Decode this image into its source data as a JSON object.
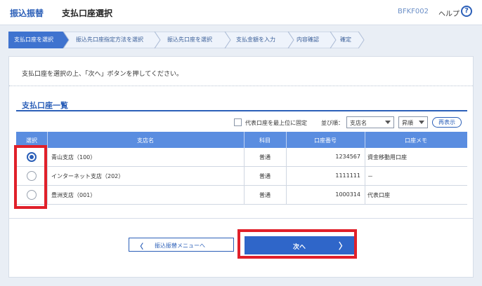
{
  "header": {
    "app_title": "振込振替",
    "page_title": "支払口座選択",
    "screen_id": "BFKF002",
    "help_label": "ヘルプ",
    "help_icon_text": "?"
  },
  "steps": [
    {
      "label": "支払口座を選択",
      "active": true
    },
    {
      "label": "振込先口座指定方法を選択",
      "active": false
    },
    {
      "label": "振込先口座を選択",
      "active": false
    },
    {
      "label": "支払金額を入力",
      "active": false
    },
    {
      "label": "内容確認",
      "active": false
    },
    {
      "label": "確定",
      "active": false
    }
  ],
  "instruction": "支払口座を選択の上、「次へ」ボタンを押してください。",
  "account_list": {
    "title": "支払口座一覧",
    "pin_option_label": "代表口座を最上位に固定",
    "sort_label": "並び順：",
    "sort_field": "支店名",
    "sort_order": "昇順",
    "redisplay_label": "再表示",
    "columns": [
      "選択",
      "支店名",
      "科目",
      "口座番号",
      "口座メモ"
    ],
    "rows": [
      {
        "selected": true,
        "branch": "青山支店（100）",
        "type": "普通",
        "number": "1234567",
        "memo": "資金移動用口座"
      },
      {
        "selected": false,
        "branch": "インターネット支店（202）",
        "type": "普通",
        "number": "1111111",
        "memo": "－"
      },
      {
        "selected": false,
        "branch": "豊洲支店（001）",
        "type": "普通",
        "number": "1000314",
        "memo": "代表口座"
      }
    ]
  },
  "buttons": {
    "back_chevron": "〈",
    "back_label": "振込振替メニューへ",
    "next_label": "次へ",
    "next_chevron": "〉"
  },
  "colors": {
    "accent": "#2b5fb8",
    "table_header": "#5a8de0",
    "highlight": "#e0202a",
    "step_active": "#3f73cf"
  }
}
